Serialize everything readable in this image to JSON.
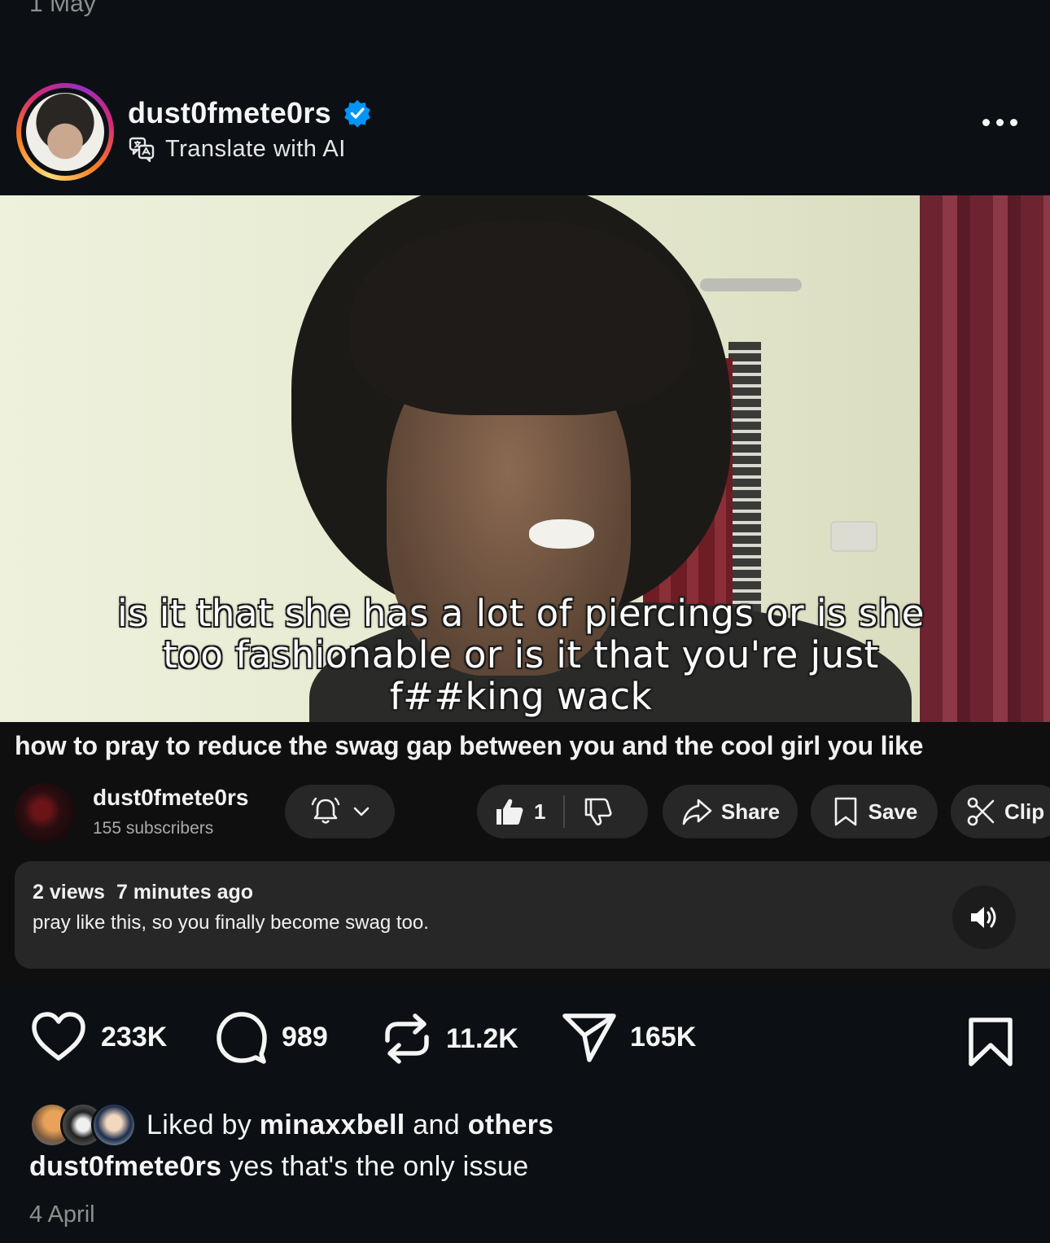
{
  "top": {
    "date": "1 May"
  },
  "post": {
    "username": "dust0fmete0rs",
    "translate_label": "Translate with AI"
  },
  "video": {
    "subtitle": "is it that she has a lot of piercings or is she too fashionable or is it that you're just f##king wack",
    "title": "how to pray to reduce the swag gap between you and the cool girl you like",
    "channel_name": "dust0fmete0rs",
    "subscribers": "155 subscribers",
    "like_count": "1",
    "share_label": "Share",
    "save_label": "Save",
    "clip_label": "Clip",
    "views": "2 views",
    "time_ago": "7 minutes ago",
    "description": "pray like this, so you finally become swag too."
  },
  "actions": {
    "likes": "233K",
    "comments": "989",
    "reposts": "11.2K",
    "shares": "165K"
  },
  "liked_by": {
    "prefix": "Liked by",
    "user": "minaxxbell",
    "and": "and",
    "others": "others"
  },
  "caption": {
    "username": "dust0fmete0rs",
    "text": "yes that's the only issue"
  },
  "post_date": "4 April",
  "colors": {
    "background": "#0c1014",
    "verified": "#0095f6",
    "yt_pill": "#272727"
  }
}
